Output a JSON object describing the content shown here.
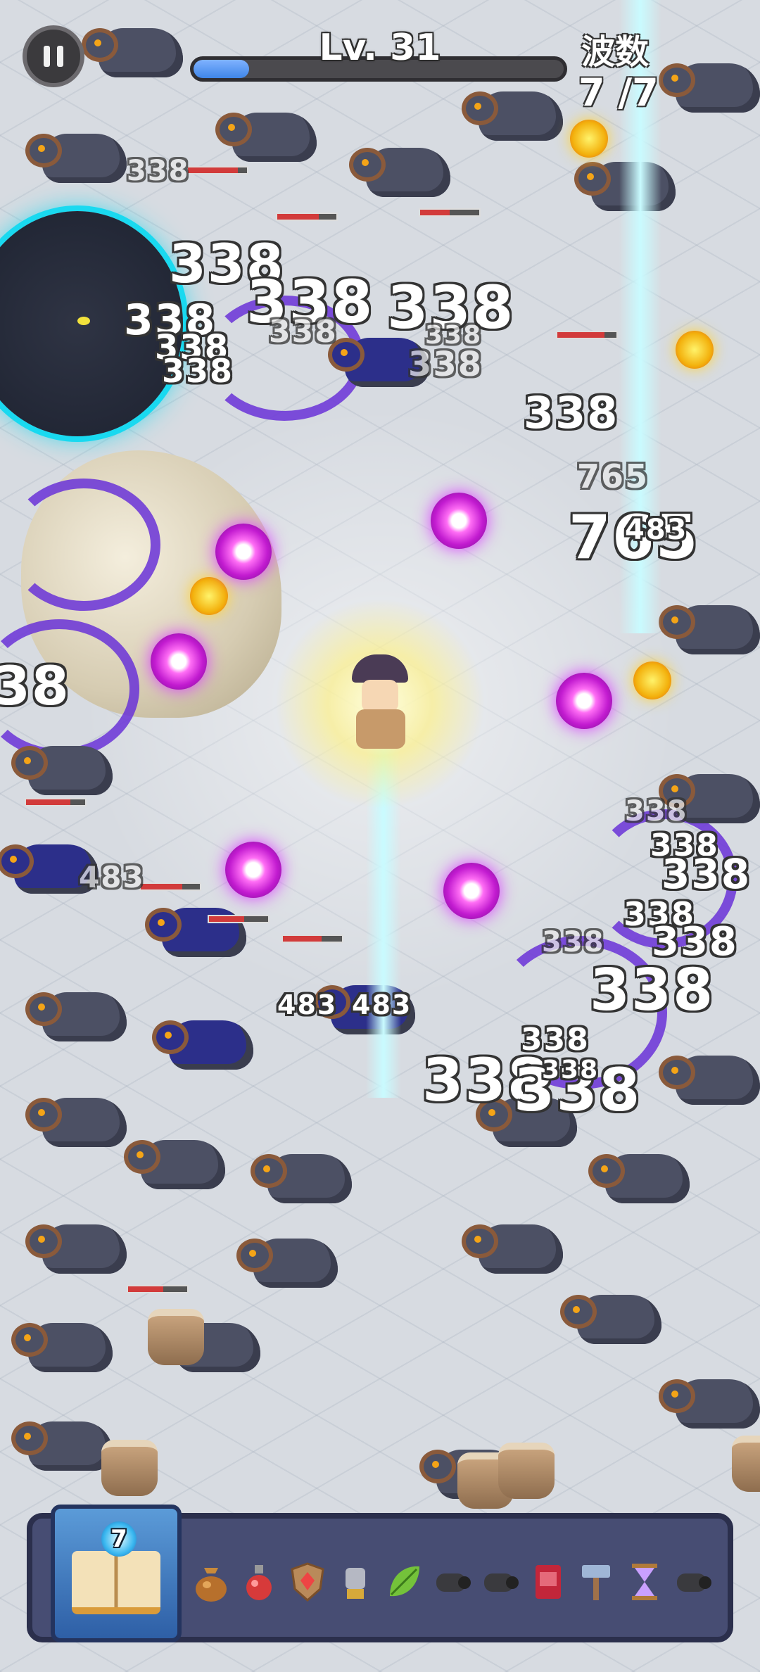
{
  "hud": {
    "level_label": "Lv. 31",
    "xp_progress": 0.15,
    "wave_label": "波数",
    "wave_count": "7 /7"
  },
  "damage_numbers": [
    "338",
    "338",
    "338",
    "338",
    "338",
    "338",
    "338",
    "338",
    "338",
    "338",
    "765",
    "765",
    "483",
    "38",
    "338",
    "338",
    "338",
    "338",
    "338",
    "338",
    "338",
    "338",
    "338",
    "338",
    "483",
    "483",
    "483",
    "338",
    "338"
  ],
  "skill_bar": {
    "book_count": "7",
    "items": [
      "coin-bag-icon",
      "potion-flask-icon",
      "shield-icon",
      "gauntlet-icon",
      "leaf-icon",
      "cannon-icon",
      "cannon-icon",
      "spellbook-icon",
      "hammer-icon",
      "hourglass-icon",
      "cannon-icon"
    ]
  },
  "colors": {
    "xp_fill": "#3f86e8",
    "hp_bar": "#d23b3b",
    "skill_bar_bg": "#474d73",
    "orb": "#c21bd0",
    "boss_aura": "#19d9f0"
  }
}
